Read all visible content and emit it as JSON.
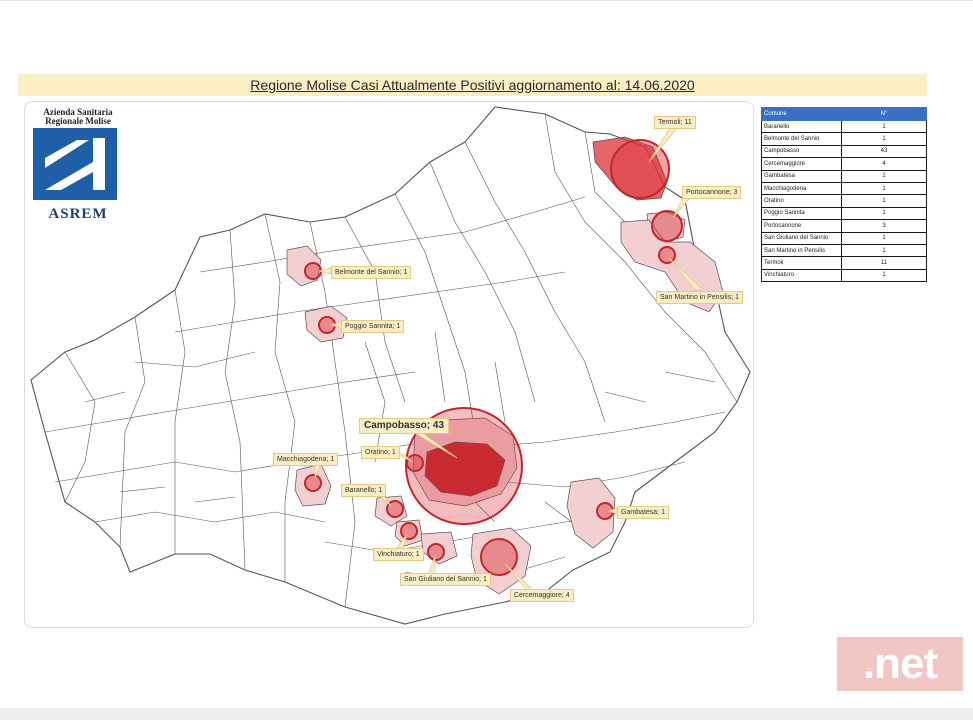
{
  "title": "Regione Molise Casi Attualmente Positivi aggiornamento al: 14.06.2020",
  "logo": {
    "org_line1": "Azienda Sanitaria",
    "org_line2": "Regionale Molise",
    "name": "ASREM"
  },
  "colors": {
    "case_fill": "#d9333a",
    "case_region_light": "#f3cfd2",
    "label_bg": "#fbeec4",
    "table_header": "#3a6fc4"
  },
  "map_labels": {
    "termoli": "Termoli; 11",
    "portocannone": "Portocannone; 3",
    "san_martino": "San Martino in Pensilis; 1",
    "belmonte": "Belmonte del Sannio; 1",
    "poggio": "Poggio Sannita; 1",
    "campobasso": "Campobasso; 43",
    "oratino": "Oratino; 1",
    "macchiagodena": "Macchiagodena; 1",
    "baranello": "Baranello; 1",
    "vinchiaturo": "Vinchiaturo; 1",
    "san_giuliano": "San Giuliano del Sannio; 1",
    "cercemaggiore": "Cercemaggiore; 4",
    "gambatesa": "Gambatesa; 1"
  },
  "table": {
    "header_comune": "Comune",
    "header_num": "N°",
    "rows": [
      {
        "comune": "Baranello",
        "n": "1"
      },
      {
        "comune": "Belmonte del Sannio",
        "n": "1"
      },
      {
        "comune": "Campobasso",
        "n": "43"
      },
      {
        "comune": "Cercemaggiore",
        "n": "4"
      },
      {
        "comune": "Gambatesa",
        "n": "1"
      },
      {
        "comune": "Macchiagodena",
        "n": "1"
      },
      {
        "comune": "Oratino",
        "n": "1"
      },
      {
        "comune": "Poggio Sannita",
        "n": "1"
      },
      {
        "comune": "Portocannone",
        "n": "3"
      },
      {
        "comune": "San Giuliano del Sannio",
        "n": "1"
      },
      {
        "comune": "San Martino in Pensilis",
        "n": "1"
      },
      {
        "comune": "Termoli",
        "n": "11"
      },
      {
        "comune": "Vinchiaturo",
        "n": "1"
      }
    ]
  },
  "watermark": ".net"
}
